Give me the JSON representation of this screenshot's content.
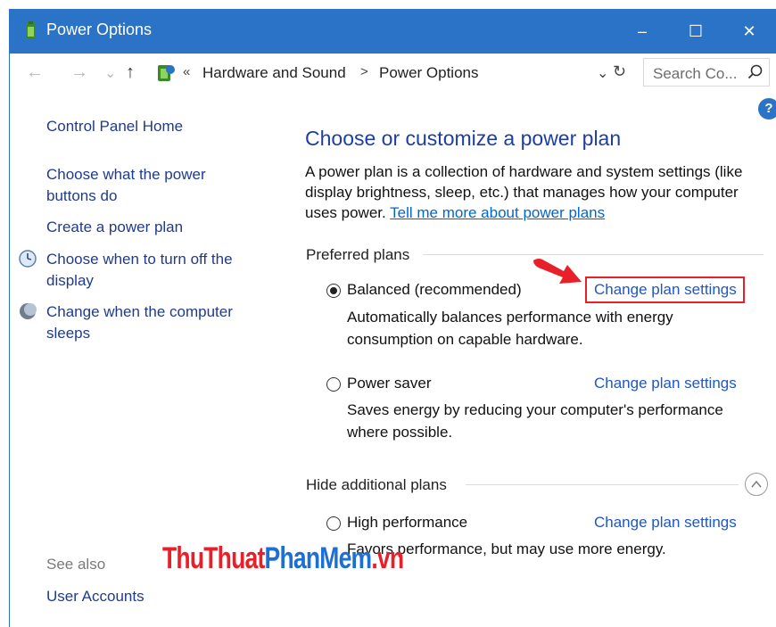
{
  "window": {
    "title": "Power Options",
    "title_icon": "power-options-icon",
    "controls": {
      "minimize": "–",
      "maximize": "☐",
      "close": "✕"
    },
    "accent": "#2b73c6"
  },
  "nav": {
    "back": "←",
    "forward": "→",
    "recent": "⌄",
    "up": "↑",
    "crumb_overflow": "«",
    "breadcrumb": [
      "Hardware and Sound",
      "Power Options"
    ],
    "separator": ">",
    "dropdown": "⌄",
    "refresh": "↻",
    "search_placeholder": "Search Co..."
  },
  "help": "?",
  "sidebar": {
    "home": "Control Panel Home",
    "links": [
      "Choose what the power buttons do",
      "Create a power plan",
      "Choose when to turn off the display",
      "Change when the computer sleeps"
    ],
    "see_also": "See also",
    "see_also_links": [
      "User Accounts"
    ]
  },
  "main": {
    "title": "Choose or customize a power plan",
    "intro": "A power plan is a collection of hardware and system settings (like display brightness, sleep, etc.) that manages how your computer uses power.",
    "intro_link": "Tell me more about power plans",
    "preferred_label": "Preferred plans",
    "hidden_label": "Hide additional plans",
    "change_link": "Change plan settings",
    "plans": [
      {
        "name": "Balanced (recommended)",
        "selected": true,
        "description": "Automatically balances performance with energy consumption on capable hardware."
      },
      {
        "name": "Power saver",
        "selected": false,
        "description": "Saves energy by reducing your computer's performance where possible."
      },
      {
        "name": "High performance",
        "selected": false,
        "description": "Favors performance, but may use more energy."
      }
    ]
  },
  "annotation": {
    "arrow_color": "#e8202a",
    "box_color": "#e8202a"
  },
  "watermark": {
    "part1": "ThuThuat",
    "part2": "PhanMem",
    "part3": ".vn"
  }
}
